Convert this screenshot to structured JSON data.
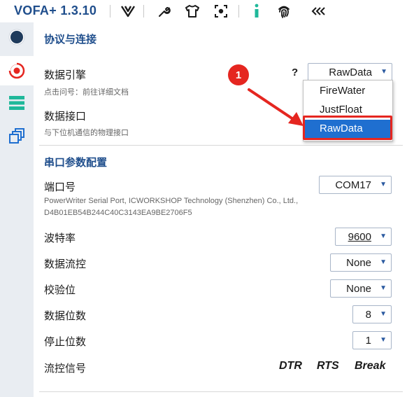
{
  "app": {
    "title": "VOFA+ 1.3.10"
  },
  "toolbar": {
    "icons": [
      "vofa-logo-icon",
      "wrench-icon",
      "tshirt-icon",
      "screenshot-icon",
      "info-icon",
      "fingerprint-icon",
      "collapse-icon"
    ]
  },
  "sidebar": {
    "items": [
      {
        "name": "record-icon",
        "active": false
      },
      {
        "name": "protocol-icon",
        "active": true
      },
      {
        "name": "list-icon",
        "active": false
      },
      {
        "name": "windows-icon",
        "active": false
      }
    ]
  },
  "protocol": {
    "section_title": "协议与连接",
    "engine_label": "数据引擎",
    "engine_hint": "点击问号：前往详细文档",
    "help_label": "?",
    "engine_value": "RawData",
    "interface_label": "数据接口",
    "interface_hint": "与下位机通信的物理接口",
    "engine_options": [
      "FireWater",
      "JustFloat",
      "RawData"
    ]
  },
  "annotation": {
    "step": "1"
  },
  "serial": {
    "section_title": "串口参数配置",
    "port_label": "端口号",
    "port_value": "COM17",
    "port_desc_line1": "PowerWriter Serial Port, ICWORKSHOP Technology (Shenzhen) Co., Ltd.,",
    "port_desc_line2": "D4B01EB54B244C40C3143EA9BE2706F5",
    "baud_label": "波特率",
    "baud_value": "9600",
    "flow_label": "数据流控",
    "flow_value": "None",
    "parity_label": "校验位",
    "parity_value": "None",
    "databits_label": "数据位数",
    "databits_value": "8",
    "stopbits_label": "停止位数",
    "stopbits_value": "1",
    "signals_label": "流控信号",
    "signals": [
      "DTR",
      "RTS",
      "Break"
    ]
  },
  "colors": {
    "accent": "#1f4e8c",
    "highlight": "#e52620",
    "selection": "#1f6fd0"
  }
}
